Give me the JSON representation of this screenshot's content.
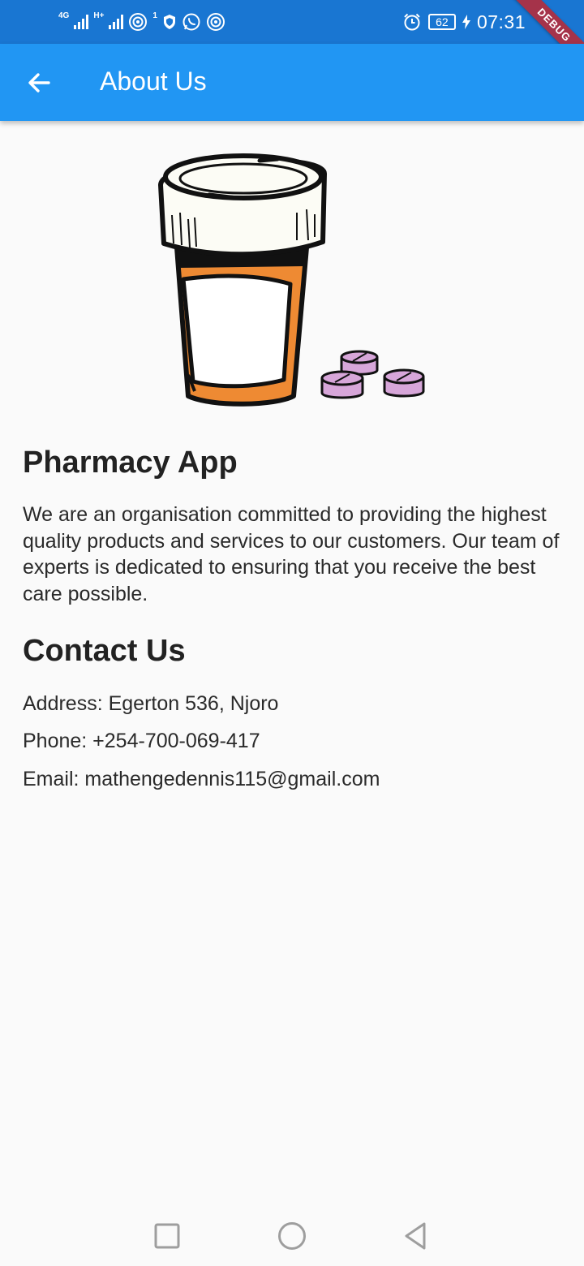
{
  "status_bar": {
    "network_1": "4G",
    "network_2": "H+",
    "hotspot_count": "1",
    "battery": "62",
    "time": "07:31"
  },
  "debug_banner": "DEBUG",
  "app_bar": {
    "title": "About Us",
    "back_icon": "arrow-back-icon",
    "color": "#2196f3"
  },
  "about": {
    "title": "Pharmacy App",
    "description": "We are an organisation committed to providing the highest quality products and services to our customers. Our team of experts is dedicated to ensuring that you receive the best care possible."
  },
  "contact": {
    "title": "Contact Us",
    "address": "Address: Egerton 536, Njoro",
    "phone": "Phone: +254-700-069-417",
    "email": "Email: mathengedennis115@gmail.com"
  },
  "nav_bar": {
    "items": [
      "recents-square-icon",
      "home-circle-icon",
      "back-triangle-icon"
    ]
  }
}
